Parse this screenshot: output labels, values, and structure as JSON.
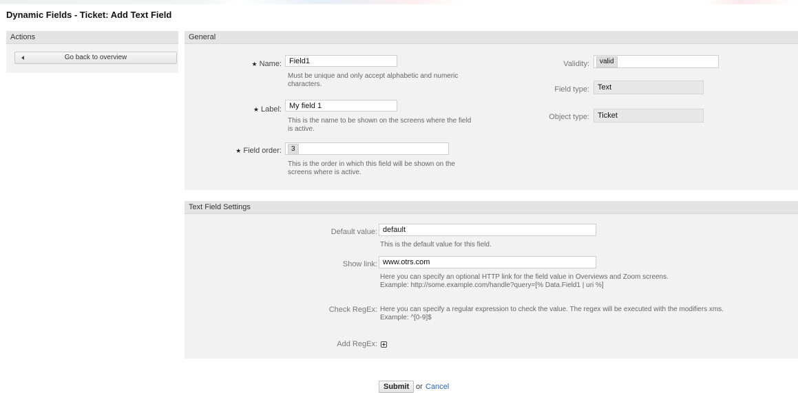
{
  "page": {
    "title": "Dynamic Fields - Ticket: Add Text Field"
  },
  "sidebar": {
    "header": "Actions",
    "back_button": "Go back to overview"
  },
  "general": {
    "header": "General",
    "name": {
      "label": "Name:",
      "value": "Field1",
      "hint_line1": "Must be unique and only accept alphabetic and numeric",
      "hint_line2": "characters."
    },
    "label": {
      "label": "Label:",
      "value": "My field 1",
      "hint_line1": "This is the name to be shown on the screens where the field",
      "hint_line2": "is active."
    },
    "field_order": {
      "label": "Field order:",
      "value": "3",
      "hint_line1": "This is the order in which this field will be shown on the",
      "hint_line2": "screens where is active."
    },
    "validity": {
      "label": "Validity:",
      "value": "valid"
    },
    "field_type": {
      "label": "Field type:",
      "value": "Text"
    },
    "object_type": {
      "label": "Object type:",
      "value": "Ticket"
    }
  },
  "text_settings": {
    "header": "Text Field Settings",
    "default_value": {
      "label": "Default value:",
      "value": "default",
      "hint": "This is the default value for this field."
    },
    "show_link": {
      "label": "Show link:",
      "value": "www.otrs.com",
      "hint_line1": "Here you can specify an optional HTTP link for the field value in Overviews and Zoom screens.",
      "hint_line2": "Example: http://some.example.com/handle?query=[% Data.Field1 | uri %]"
    },
    "check_regex": {
      "label": "Check RegEx:",
      "hint_line1": "Here you can specify a regular expression to check the value. The regex will be executed with the modifiers xms.",
      "hint_line2": "Example: ^[0-9]$"
    },
    "add_regex": {
      "label": "Add RegEx:",
      "icon": "plus-square-icon"
    }
  },
  "footer": {
    "submit": "Submit",
    "or": "or",
    "cancel": "Cancel"
  },
  "icons": {
    "required": "star-icon",
    "back": "triangle-left-icon"
  }
}
